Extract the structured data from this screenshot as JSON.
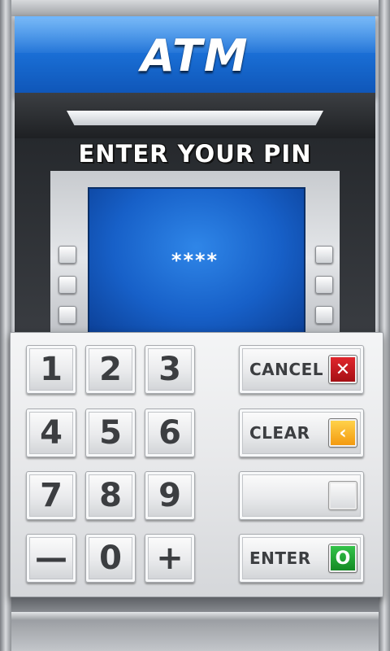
{
  "header": {
    "title": "ATM"
  },
  "screen": {
    "prompt": "ENTER YOUR PIN",
    "pin_display": "****"
  },
  "keypad": {
    "digits": [
      [
        "1",
        "2",
        "3"
      ],
      [
        "4",
        "5",
        "6"
      ],
      [
        "7",
        "8",
        "9"
      ],
      [
        "—",
        "0",
        "+"
      ]
    ],
    "functions": {
      "cancel": {
        "label": "CANCEL",
        "icon": "close-icon",
        "icon_glyph": "✕",
        "color": "#d41f25"
      },
      "clear": {
        "label": "CLEAR",
        "icon": "chevron-left-icon",
        "icon_glyph": "‹",
        "color": "#f5a623"
      },
      "blank": {
        "label": "",
        "icon": "blank-icon",
        "icon_glyph": "",
        "color": "#e9e9e9"
      },
      "enter": {
        "label": "ENTER",
        "icon": "circle-icon",
        "icon_glyph": "O",
        "color": "#1fa233"
      }
    }
  },
  "colors": {
    "header_blue": "#1a6fd6",
    "screen_blue": "#1760c8",
    "panel_silver": "#e7e8ea"
  }
}
